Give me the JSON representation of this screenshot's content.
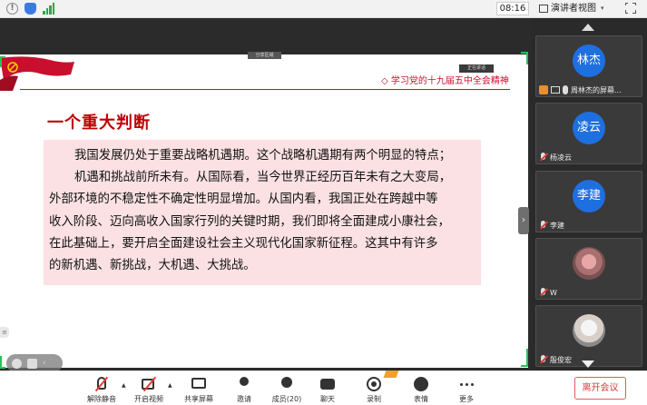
{
  "topbar": {
    "time": "08:16",
    "view_label": "演讲者视图",
    "view_caret": "▾"
  },
  "share": {
    "tag_top": "分享区域",
    "tag_right": "正在讲话"
  },
  "slide": {
    "header": "◇ 学习党的十九届五中全会精神",
    "title": "一个重大判断",
    "lines": [
      "我国发展仍处于重要战略机遇期。这个战略机遇期有两个明显的特点；",
      "机遇和挑战前所未有。从国际看，当今世界正经历百年未有之大变局，",
      "外部环境的不稳定性不确定性明显增加。从国内看，我国正处在跨越中等",
      "收入阶段、迈向高收入国家行列的关键时期，我们即将全面建成小康社会，",
      "在此基础上，要开启全面建设社会主义现代化国家新征程。这其中有许多",
      "的新机遇、新挑战，大机遇、大挑战。"
    ]
  },
  "participants": [
    {
      "avatar_text": "林杰",
      "name": "周林杰的屏幕...",
      "color": "#1e6fe0"
    },
    {
      "avatar_text": "凌云",
      "name": "杨凌云",
      "color": "#1e6fe0"
    },
    {
      "avatar_text": "李建",
      "name": "李建",
      "color": "#1e6fe0"
    },
    {
      "avatar_text": "",
      "name": "W",
      "color": ""
    },
    {
      "avatar_text": "",
      "name": "殷俊宏",
      "color": ""
    }
  ],
  "toolbar": {
    "unmute": "解除静音",
    "start_video": "开启视频",
    "share_screen": "共享屏幕",
    "invite": "邀请",
    "members": "成员(20)",
    "chat": "聊天",
    "record": "录制",
    "emoji": "表情",
    "more": "更多",
    "leave": "离开会议"
  }
}
